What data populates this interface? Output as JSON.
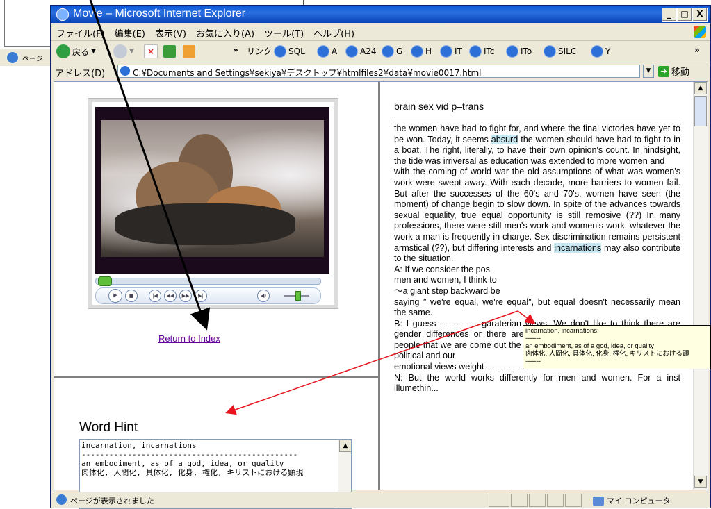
{
  "background_window": {
    "status_text": "ページ"
  },
  "window": {
    "title": "Movie – Microsoft Internet Explorer",
    "caption_buttons": {
      "minimize": "_",
      "maximize": "□",
      "close": "X"
    }
  },
  "menu": {
    "items": [
      "ファイル(F)",
      "編集(E)",
      "表示(V)",
      "お気に入り(A)",
      "ツール(T)",
      "ヘルプ(H)"
    ]
  },
  "toolbar": {
    "back_label": "戻る",
    "chevron": "»",
    "links_label": "リンク",
    "links": [
      "SQL",
      "A",
      "A24",
      "G",
      "H",
      "IT",
      "ITc",
      "ITo",
      "SILC",
      "Y"
    ]
  },
  "address": {
    "label": "アドレス(D)",
    "value": "C:¥Documents and Settings¥sekiya¥デスクトップ¥htmlfiles2¥data¥movie0017.html",
    "go_label": "移動"
  },
  "player": {
    "return_link": "Return to Index"
  },
  "hint": {
    "title": "Word Hint",
    "text": "incarnation, incarnations\n-----------------------------------------------\nan embodiment, as of a god, idea, or quality\n肉体化, 人間化, 具体化, 化身, 権化, キリストにおける顕現"
  },
  "article": {
    "title": "brain sex vid p–trans",
    "p1_a": "the women have had to fight for, and where the final victories have yet to be won. Today, it seems ",
    "p1_hl": "absurd",
    "p1_b": " the women should have had to fight to in a boat. The right, literally, to have their own opinion's count. In hindsight, the tide was irriversal as education was extended to more women and",
    "p2_a": "with the coming of world war the old assumptions of what was women's work were swept away. With each decade, more barriers to women fail. But after the successes of the 60's and 70's, women have seen (the moment) of change begin to slow down. In spite of the advances towards sexual equality, true equal opportunity is still remosive (??) In many professions, there were still men's work and women's work, whatever the work a man is frequently in charge. Sex discrimination remains persistent armstical (??), but differing interests and ",
    "p2_hl": "incarnations",
    "p2_b": " may also contribute to the situation.",
    "p3": "A: If we consider the pos",
    "p4": "men and women, I think to",
    "p5": "〜a giant step backward be",
    "p6": "saying ″ we're equal, we're equal″, but equal doesn't necessarily mean the same.",
    "p7": "B: I guess ------------- garaterian views. We don't like to think there are gender differences or there are group differences between groups of people that we are come out the same. And that doesn't really fit with our political and our",
    "p8": "emotional views weight-------------------",
    "p9": "N: But the world works differently for men and women. For a inst illumethin..."
  },
  "tooltip": {
    "text": "incarnation, incarnations:\n-------\nan embodiment, as of a god, idea, or quality\n肉体化, 人間化, 具体化, 化身, 権化, キリストにおける顕\n-------"
  },
  "status": {
    "text": "ページが表示されました",
    "zone": "マイ コンピュータ"
  },
  "colors": {
    "title_bar": "#0a58d8",
    "highlight": "#c6e8f2",
    "link": "#660099",
    "arrow": "#e8141e",
    "tooltip_bg": "#ffffe1"
  }
}
